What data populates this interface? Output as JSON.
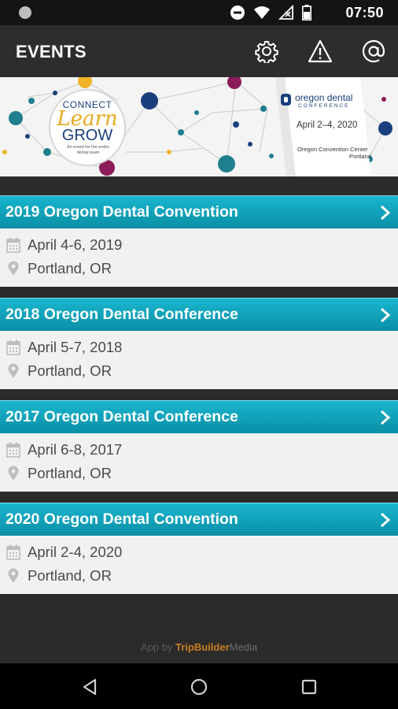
{
  "status_bar": {
    "time": "07:50",
    "icons": [
      "notification-dot-icon",
      "do-not-disturb-icon",
      "wifi-icon",
      "no-signal-icon",
      "battery-icon"
    ]
  },
  "app_bar": {
    "title": "EVENTS",
    "actions": [
      "settings-gear-icon",
      "warning-icon",
      "at-sign-icon"
    ]
  },
  "banner": {
    "tagline_connect": "CONNECT",
    "tagline_learn": "Learn",
    "tagline_grow": "GROW",
    "tagline_sub": "An event for the entire dental team",
    "logo_name": "oregon dental",
    "logo_sub": "CONFERENCE",
    "dates": "April 2–4, 2020",
    "venue_line1": "Oregon Convention Center",
    "venue_line2": "Portland"
  },
  "events": [
    {
      "name": "2019 Oregon Dental Convention",
      "dates": "April 4-6, 2019",
      "location": "Portland, OR"
    },
    {
      "name": "2018 Oregon Dental Conference",
      "dates": "April 5-7, 2018",
      "location": "Portland, OR"
    },
    {
      "name": "2017 Oregon Dental Conference",
      "dates": "April 6-8, 2017",
      "location": "Portland, OR"
    },
    {
      "name": "2020 Oregon Dental Convention",
      "dates": "April 2-4, 2020",
      "location": "Portland, OR"
    }
  ],
  "footer": {
    "prefix": "App by ",
    "brand": "TripBuilder",
    "brand_suffix": "Media"
  },
  "colors": {
    "accent": "#0fa3ba",
    "header_bg": "#2d2d2d",
    "card_bg": "#f1f1f1",
    "banner_teal": "#1f7f8e",
    "banner_navy": "#1b3f7d",
    "banner_maroon": "#8a1b58",
    "banner_gold": "#f0b428"
  }
}
